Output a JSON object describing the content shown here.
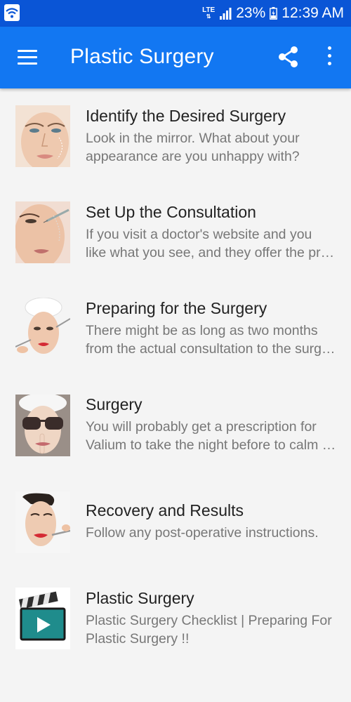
{
  "status_bar": {
    "network": "LTE",
    "battery": "23%",
    "time": "12:39 AM"
  },
  "app_bar": {
    "title": "Plastic Surgery",
    "menu_icon": "hamburger-menu-icon",
    "share_icon": "share-icon",
    "more_icon": "more-vert-icon"
  },
  "articles": [
    {
      "title": "Identify the Desired Surgery",
      "desc_line1": "Look in the mirror. What about your",
      "desc_line2": "appearance are you unhappy with?"
    },
    {
      "title": "Set Up the Consultation",
      "desc_line1": "If you visit a doctor's website and you",
      "desc_line2": "like what you see, and they offer the pro…"
    },
    {
      "title": "Preparing for the Surgery",
      "desc_line1": "There might be as long as two months",
      "desc_line2": "from the actual consultation to the surg…"
    },
    {
      "title": "Surgery",
      "desc_line1": "You will probably get a prescription for",
      "desc_line2": "Valium to take the night before to calm …"
    },
    {
      "title": "Recovery and Results",
      "desc_line1": "Follow any post-operative instructions.",
      "desc_line2": ""
    },
    {
      "title": "Plastic Surgery",
      "desc_line1": "Plastic Surgery Checklist | Preparing For",
      "desc_line2": "Plastic Surgery !!"
    }
  ],
  "colors": {
    "status_bar": "#0a55d6",
    "app_bar": "#1277f2",
    "background": "#f4f4f4"
  }
}
